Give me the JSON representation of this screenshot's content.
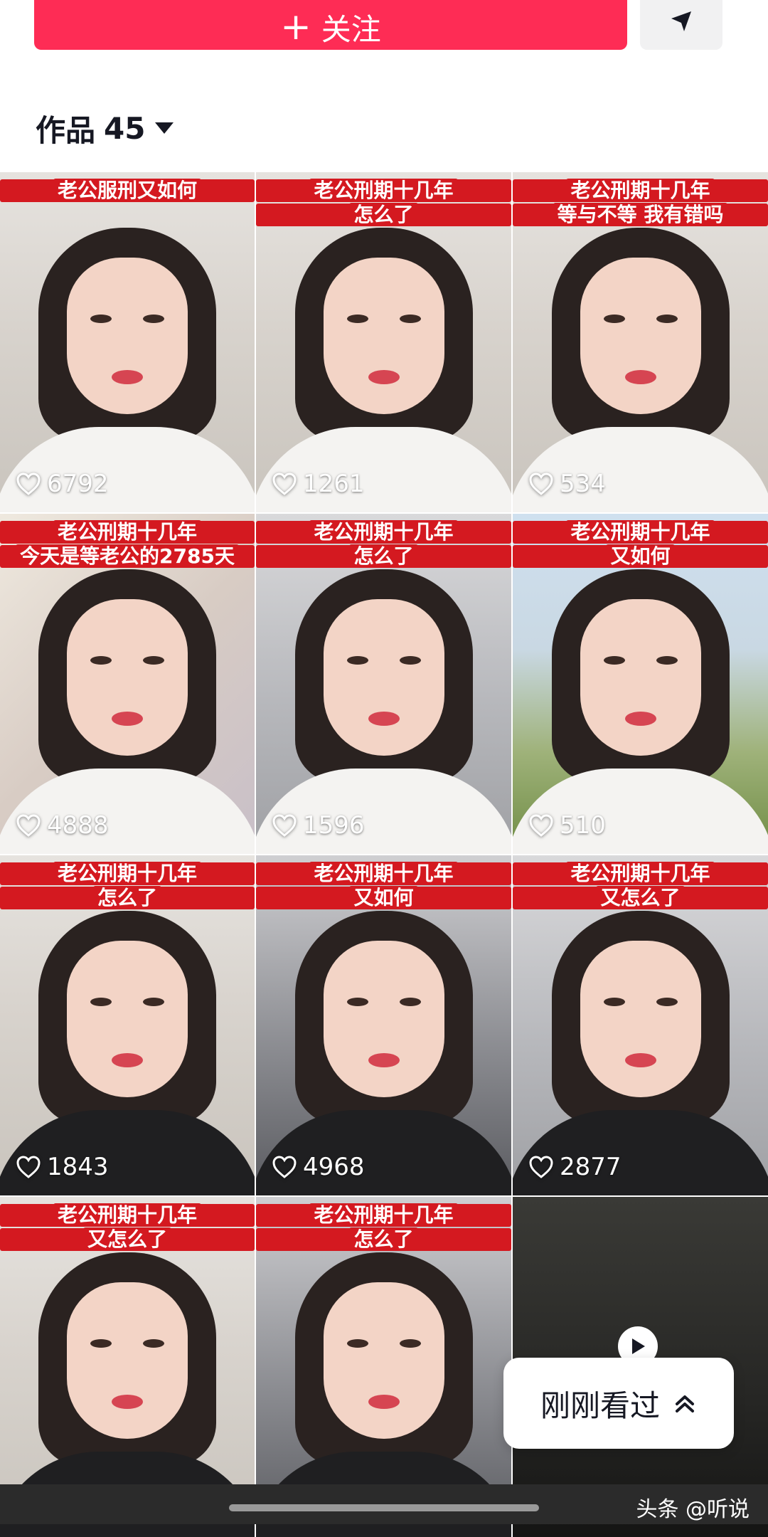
{
  "header": {
    "follow_plus": "+",
    "follow_label": "关注",
    "share_icon": "send-icon"
  },
  "works": {
    "label": "作品",
    "count": "45"
  },
  "grid": {
    "tiles": [
      {
        "caption": [
          "老公服刑又如何"
        ],
        "likes": "6792"
      },
      {
        "caption": [
          "老公刑期十几年",
          "怎么了"
        ],
        "likes": "1261"
      },
      {
        "caption": [
          "老公刑期十几年",
          "等与不等 我有错吗"
        ],
        "likes": "534"
      },
      {
        "caption": [
          "老公刑期十几年",
          "今天是等老公的2785天"
        ],
        "likes": "4888"
      },
      {
        "caption": [
          "老公刑期十几年",
          "怎么了"
        ],
        "likes": "1596"
      },
      {
        "caption": [
          "老公刑期十几年",
          "又如何"
        ],
        "likes": "510"
      },
      {
        "caption": [
          "老公刑期十几年",
          "怎么了"
        ],
        "likes": "1843"
      },
      {
        "caption": [
          "老公刑期十几年",
          "又如何"
        ],
        "likes": "4968"
      },
      {
        "caption": [
          "老公刑期十几年",
          "又怎么了"
        ],
        "likes": "2877"
      },
      {
        "caption": [
          "老公刑期十几年",
          "又怎么了"
        ],
        "likes": ""
      },
      {
        "caption": [
          "老公刑期十几年",
          "怎么了"
        ],
        "likes": ""
      },
      {
        "caption": [],
        "likes": ""
      }
    ]
  },
  "recent": {
    "label": "刚刚看过"
  },
  "watermark": {
    "text": "头条 @听说"
  },
  "colors": {
    "accent": "#fe2c55",
    "caption_bg": "#d41920"
  }
}
